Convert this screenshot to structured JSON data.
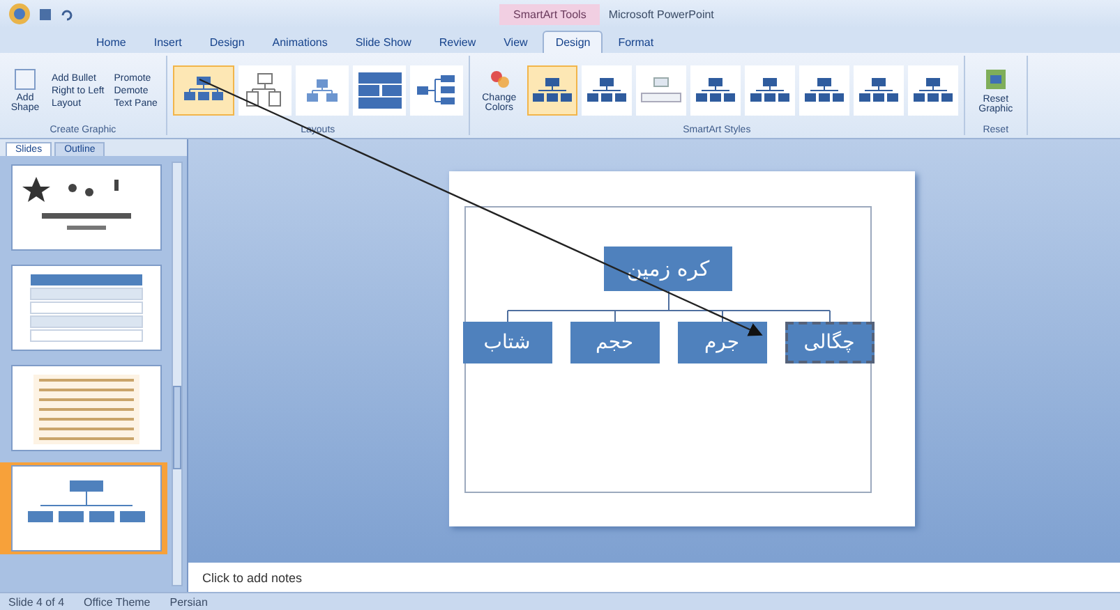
{
  "title_bar": {
    "contextual_tab": "SmartArt Tools",
    "title": "Microsoft PowerPoint"
  },
  "tabs": [
    {
      "label": "Home",
      "selected": false
    },
    {
      "label": "Insert",
      "selected": false
    },
    {
      "label": "Design",
      "selected": false
    },
    {
      "label": "Animations",
      "selected": false
    },
    {
      "label": "Slide Show",
      "selected": false
    },
    {
      "label": "Review",
      "selected": false
    },
    {
      "label": "View",
      "selected": false
    },
    {
      "label": "Design",
      "selected": true
    },
    {
      "label": "Format",
      "selected": false
    }
  ],
  "ribbon": {
    "create_graphic": {
      "label": "Create Graphic",
      "add_shape": "Add Shape",
      "add_bullet": "Add Bullet",
      "right_to_left": "Right to Left",
      "layout": "Layout",
      "promote": "Promote",
      "demote": "Demote",
      "text_pane": "Text Pane"
    },
    "layouts": {
      "label": "Layouts",
      "items": [
        {
          "kind": "hierarchy",
          "selected": true
        },
        {
          "kind": "outline",
          "selected": false
        },
        {
          "kind": "pyramid",
          "selected": false
        },
        {
          "kind": "table",
          "selected": false
        },
        {
          "kind": "horizontal",
          "selected": false
        }
      ]
    },
    "styles": {
      "label": "SmartArt Styles",
      "change_colors": "Change Colors",
      "items": [
        {
          "kind": "filled",
          "selected": true
        },
        {
          "kind": "filled",
          "selected": false
        },
        {
          "kind": "pale",
          "selected": false
        },
        {
          "kind": "filled",
          "selected": false
        },
        {
          "kind": "filled",
          "selected": false
        },
        {
          "kind": "filled",
          "selected": false
        },
        {
          "kind": "filled",
          "selected": false
        },
        {
          "kind": "filled",
          "selected": false
        }
      ]
    },
    "reset": {
      "label": "Reset",
      "reset_graphic": "Reset Graphic"
    }
  },
  "sidebar": {
    "tabs": [
      {
        "label": "Slides",
        "selected": true
      },
      {
        "label": "Outline",
        "selected": false
      }
    ],
    "slides": [
      {
        "kind": "title",
        "selected": false
      },
      {
        "kind": "table",
        "selected": false
      },
      {
        "kind": "list",
        "selected": false
      },
      {
        "kind": "smartart",
        "selected": true
      }
    ]
  },
  "slide": {
    "smartart": {
      "root": "کره زمین",
      "children": [
        {
          "label": "چگالی",
          "selected": true
        },
        {
          "label": "جرم",
          "selected": false
        },
        {
          "label": "حجم",
          "selected": false
        },
        {
          "label": "شتاب",
          "selected": false
        }
      ]
    }
  },
  "notes": {
    "placeholder": "Click to add notes"
  },
  "status_bar": {
    "slide": "Slide 4 of 4",
    "theme": "Office Theme",
    "language": "Persian"
  }
}
